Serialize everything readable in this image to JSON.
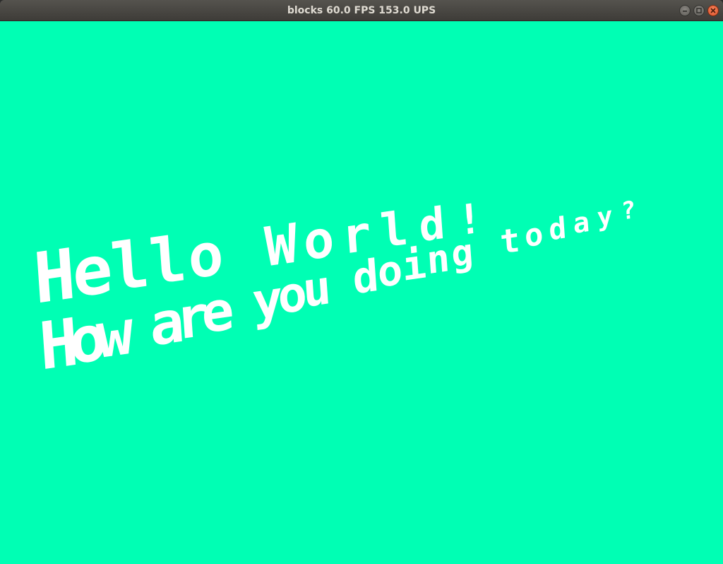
{
  "window": {
    "title": "blocks 60.0 FPS 153.0 UPS",
    "buttons": {
      "minimize": "minimize-icon",
      "maximize": "maximize-icon",
      "close": "close-icon"
    }
  },
  "scene": {
    "background_color": "#00ffb4",
    "text_color": "#ffffff",
    "lines": [
      "Hello World!",
      "How are you doing today?"
    ]
  }
}
